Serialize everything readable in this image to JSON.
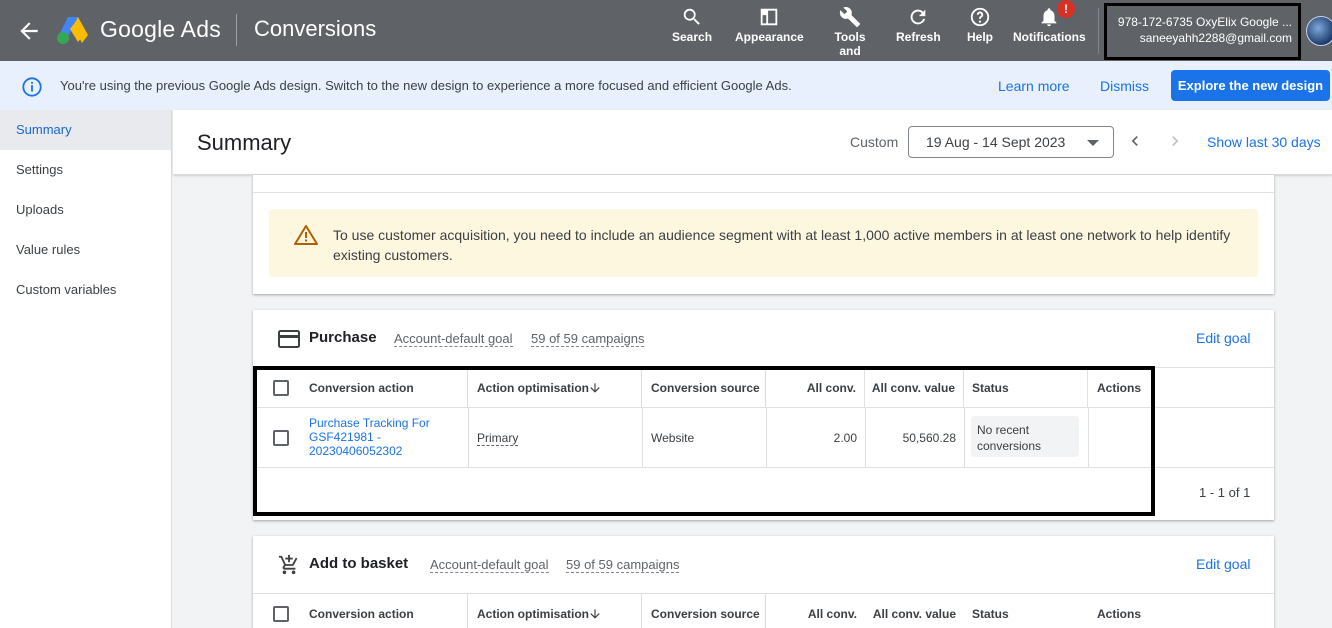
{
  "header": {
    "product_name": "Google Ads",
    "page_name": "Conversions",
    "tools": [
      {
        "label": "Search",
        "icon": "search-icon"
      },
      {
        "label": "Appearance",
        "icon": "appearance-icon"
      },
      {
        "label": "Tools and",
        "icon": "wrench-icon"
      },
      {
        "label": "Refresh",
        "icon": "refresh-icon"
      },
      {
        "label": "Help",
        "icon": "help-icon"
      },
      {
        "label": "Notifications",
        "icon": "bell-icon"
      }
    ],
    "notification_badge": "!",
    "account_id": "978-172-6735 OxyElix Google ...",
    "account_email": "saneeyahh2288@gmail.com"
  },
  "banner": {
    "text": "You're using the previous Google Ads design. Switch to the new design to experience a more focused and efficient Google Ads.",
    "learn_more": "Learn more",
    "dismiss": "Dismiss",
    "explore": "Explore the new design"
  },
  "sidebar": {
    "items": [
      {
        "label": "Summary",
        "active": true
      },
      {
        "label": "Settings"
      },
      {
        "label": "Uploads"
      },
      {
        "label": "Value rules"
      },
      {
        "label": "Custom variables"
      }
    ]
  },
  "summary": {
    "title": "Summary",
    "custom_label": "Custom",
    "date_range": "19 Aug - 14 Sept 2023",
    "show_last": "Show last 30 days"
  },
  "warning": {
    "text": "To use customer acquisition, you need to include an audience segment with at least 1,000 active members in at least one network to help identify existing customers."
  },
  "table_headers": {
    "conversion_action": "Conversion action",
    "action_optimisation": "Action optimisation",
    "conversion_source": "Conversion source",
    "all_conv": "All conv.",
    "all_conv_value": "All conv. value",
    "status": "Status",
    "actions": "Actions"
  },
  "purchase": {
    "title": "Purchase",
    "goal_type": "Account-default goal",
    "campaigns": "59 of 59 campaigns",
    "edit_goal": "Edit goal",
    "row": {
      "conversion_action": "Purchase Tracking For GSF421981 - 20230406052302",
      "action_optimisation": "Primary",
      "conversion_source": "Website",
      "all_conv": "2.00",
      "all_conv_value": "50,560.28",
      "status": "No recent conversions"
    },
    "pager": "1 - 1 of 1"
  },
  "basket": {
    "title": "Add to basket",
    "goal_type": "Account-default goal",
    "campaigns": "59 of 59 campaigns",
    "edit_goal": "Edit goal"
  },
  "colors": {
    "topbar": "#5f6368",
    "banner": "#e8f0fe",
    "link": "#1a73e8",
    "warning_bg": "#fef7e0",
    "badge": "#d93025"
  }
}
